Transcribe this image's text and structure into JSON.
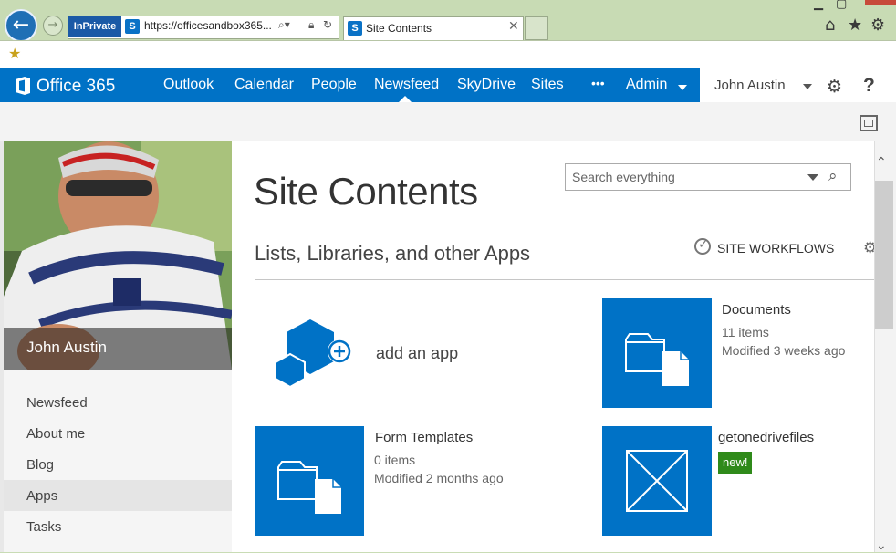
{
  "browser": {
    "inprivate_label": "InPrivate",
    "url": "https://officesandbox365...",
    "tab_title": "Site Contents",
    "favicon_letter": "S"
  },
  "suitebar": {
    "brand": "Office 365",
    "nav": [
      "Outlook",
      "Calendar",
      "People",
      "Newsfeed",
      "SkyDrive",
      "Sites",
      "•••",
      "Admin"
    ],
    "active_nav": "Newsfeed",
    "user_name": "John Austin",
    "help": "?"
  },
  "profile": {
    "name": "John Austin",
    "links": [
      "Newsfeed",
      "About me",
      "Blog",
      "Apps",
      "Tasks"
    ],
    "selected_link": "Apps"
  },
  "page": {
    "title": "Site Contents",
    "search_placeholder": "Search everything",
    "section_title": "Lists, Libraries, and other Apps",
    "site_workflows": "SITE WORKFLOWS"
  },
  "tiles": {
    "add_app": {
      "label": "add an app"
    },
    "documents": {
      "title": "Documents",
      "count": "11 items",
      "modified": "Modified 3 weeks ago"
    },
    "form_templates": {
      "title": "Form Templates",
      "count": "0 items",
      "modified": "Modified 2 months ago"
    },
    "getonedrivefiles": {
      "title": "getonedrivefiles",
      "badge": "new!"
    }
  },
  "colors": {
    "brand_blue": "#0072c6",
    "new_badge": "#2f8a1a",
    "chrome_green": "#c8dbb4"
  }
}
